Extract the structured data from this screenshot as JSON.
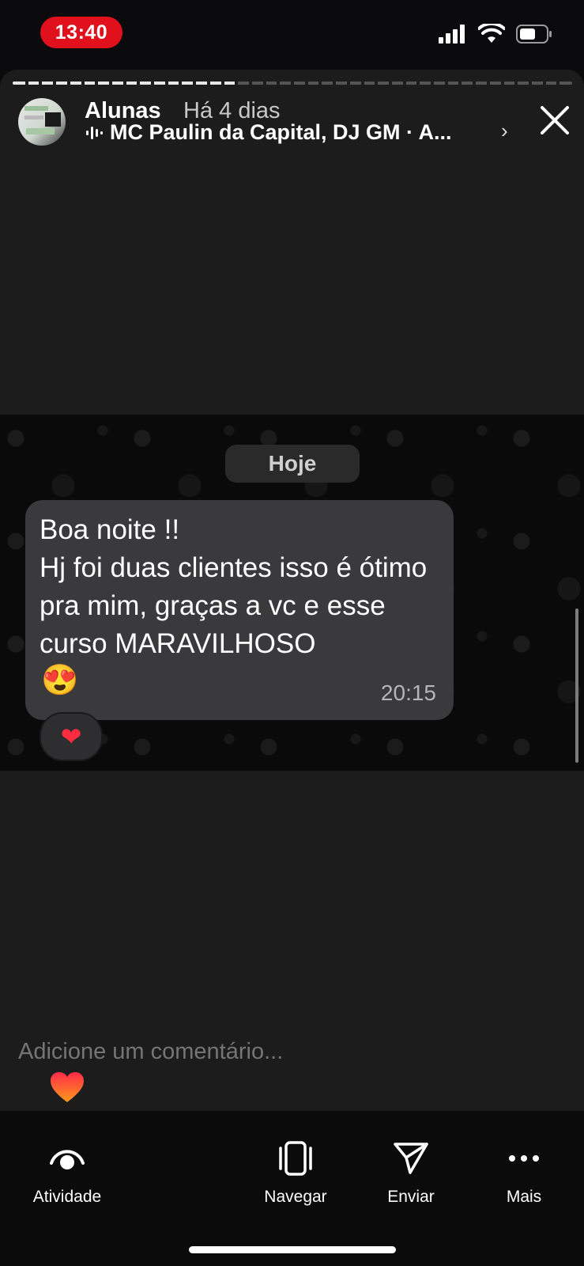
{
  "status_bar": {
    "time": "13:40",
    "icons": [
      "signal-icon",
      "wifi-icon",
      "battery-icon"
    ]
  },
  "story": {
    "progress": 0.4,
    "user": "Alunas",
    "posted": "Há 4 dias",
    "music": "MC Paulin da Capital, DJ GM · A...",
    "chevron": "›"
  },
  "chat": {
    "date_chip": "Hoje",
    "message": "Boa noite !!\nHj foi duas clientes isso é ótimo pra mim, graças a vc e esse curso MARAVILHOSO",
    "message_emoji": "😍",
    "time": "20:15",
    "reaction": "❤"
  },
  "comment": {
    "placeholder": "Adicione um comentário..."
  },
  "bottom_nav": [
    {
      "label": "Atividade",
      "icon": "eye-icon"
    },
    {
      "label": "Navegar",
      "icon": "phone-frame-icon"
    },
    {
      "label": "Enviar",
      "icon": "send-icon"
    },
    {
      "label": "Mais",
      "icon": "more-icon"
    }
  ],
  "colors": {
    "time_pill": "#e0101d",
    "bubble": "#3a3a3c",
    "reaction_heart": "#ff2d3f"
  }
}
